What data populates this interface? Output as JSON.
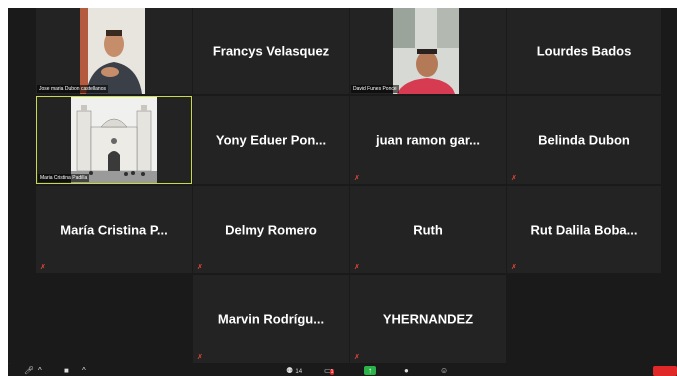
{
  "participants": [
    {
      "name": "Jose maria Dubon castellanos",
      "video": true
    },
    {
      "name": "Francys Velasquez",
      "video": false
    },
    {
      "name": "David Funes Ponce",
      "video": true
    },
    {
      "name": "Lourdes Bados",
      "video": false
    },
    {
      "name": "Maria Cristina Padilla",
      "video": true,
      "active_speaker": true
    },
    {
      "name": "Yony Eduer Pon...",
      "video": false
    },
    {
      "name": "juan ramon gar...",
      "video": false
    },
    {
      "name": "Belinda Dubon",
      "video": false
    },
    {
      "name": "María Cristina P...",
      "video": false
    },
    {
      "name": "Delmy Romero",
      "video": false
    },
    {
      "name": "Ruth",
      "video": false
    },
    {
      "name": "Rut Dalila Boba...",
      "video": false
    },
    {
      "name": "Marvin Rodrígu...",
      "video": false
    },
    {
      "name": "YHERNANDEZ",
      "video": false
    }
  ],
  "toolbar": {
    "participants_count": "14",
    "chat_badge": "1",
    "icons": [
      "mute-mic-icon",
      "caret-up-icon",
      "stop-video-icon",
      "caret-up-icon",
      "participants-icon",
      "chat-icon",
      "share-screen-icon",
      "record-icon",
      "reactions-icon"
    ]
  },
  "colors": {
    "background": "#1a1a1a",
    "tile": "#232323",
    "active_border": "#c9d94a",
    "muted": "#e0463a",
    "leave_button": "#e02828",
    "share_button": "#2bb34a"
  }
}
